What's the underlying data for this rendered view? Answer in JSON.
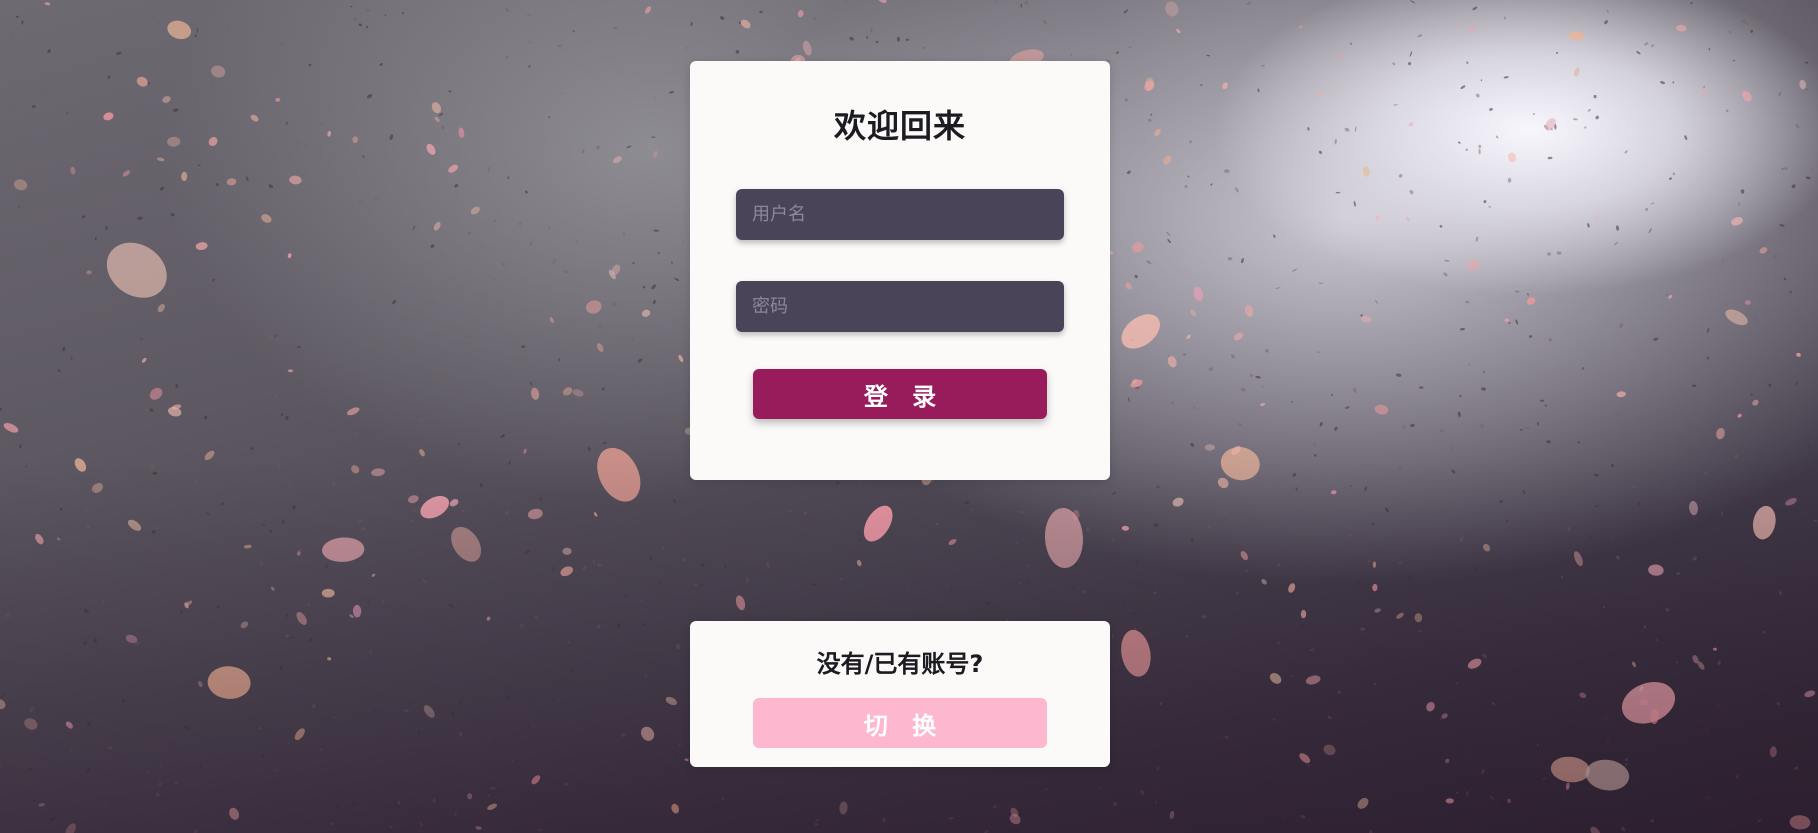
{
  "login": {
    "title": "欢迎回来",
    "username_placeholder": "用户名",
    "password_placeholder": "密码",
    "submit_label": "登 录"
  },
  "switch": {
    "prompt": "没有/已有账号?",
    "button_label": "切 换"
  },
  "colors": {
    "card_bg": "#fbfaf8",
    "input_bg": "#4a4458",
    "login_button": "#981b5c",
    "switch_button": "#fdb8cf"
  }
}
